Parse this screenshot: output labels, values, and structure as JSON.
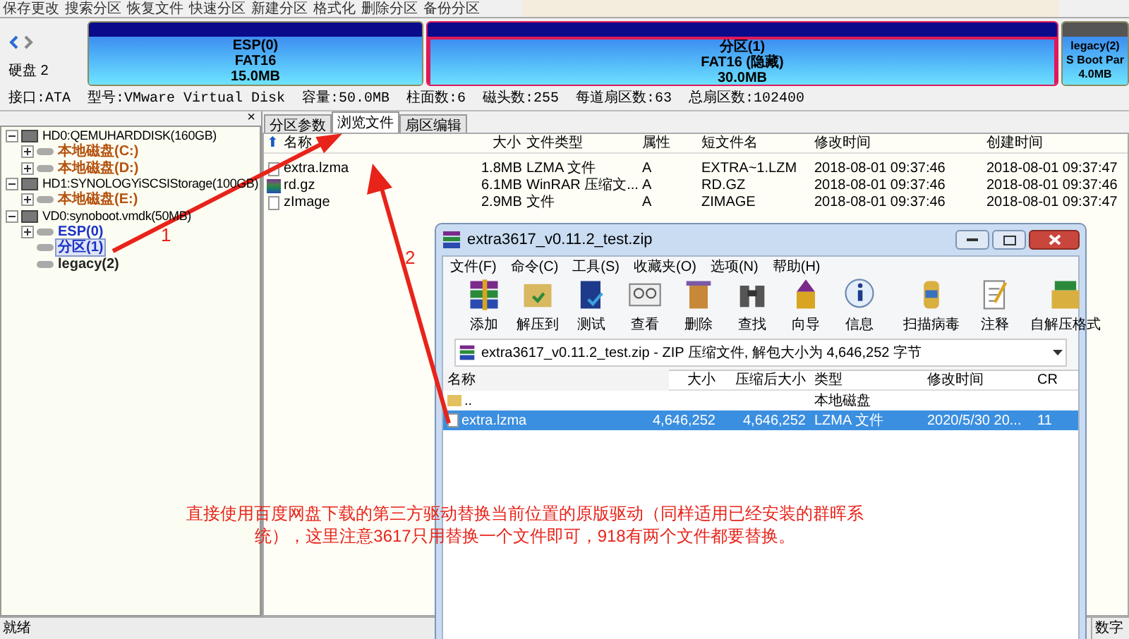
{
  "toolbar": [
    "保存更改",
    "搜索分区",
    "恢复文件",
    "快速分区",
    "新建分区",
    "格式化",
    "删除分区",
    "备份分区"
  ],
  "disk_bar": {
    "label": "硬盘 2",
    "partitions": [
      {
        "name": "ESP(0)",
        "fs": "FAT16",
        "size": "15.0MB",
        "selected": false
      },
      {
        "name": "分区(1)",
        "fs": "FAT16 (隐藏)",
        "size": "30.0MB",
        "selected": true
      },
      {
        "name": "legacy(2)",
        "fs": "S Boot Par",
        "size": "4.0MB",
        "selected": false
      }
    ]
  },
  "disk_info": "接口:ATA  型号:VMware Virtual Disk  容量:50.0MB  柱面数:6  磁头数:255  每道扇区数:63  总扇区数:102400",
  "tree_panel": {
    "close": "×"
  },
  "tree": [
    {
      "label": "HD0:QEMUHARDDISK(160GB)",
      "kind": "disk",
      "expanded": true,
      "children": [
        {
          "label": "本地磁盘(C:)",
          "kind": "partition",
          "expander": true,
          "selected": false,
          "color": "#b5530f"
        },
        {
          "label": "本地磁盘(D:)",
          "kind": "partition",
          "expander": true,
          "selected": false,
          "color": "#b5530f"
        }
      ]
    },
    {
      "label": "HD1:SYNOLOGYiSCSIStorage(100GB)",
      "kind": "disk",
      "expanded": true,
      "children": [
        {
          "label": "本地磁盘(E:)",
          "kind": "partition",
          "expander": true,
          "selected": false,
          "color": "#b5530f"
        }
      ]
    },
    {
      "label": "VD0:synoboot.vmdk(50MB)",
      "kind": "disk",
      "expanded": true,
      "children": [
        {
          "label": "ESP(0)",
          "kind": "partition",
          "expander": true,
          "selected": false,
          "color": "#1a33c8"
        },
        {
          "label": "分区(1)",
          "kind": "partition",
          "expander": false,
          "selected": true,
          "color": "#1a33c8"
        },
        {
          "label": "legacy(2)",
          "kind": "partition",
          "expander": false,
          "selected": false,
          "color": "#222222"
        }
      ]
    }
  ],
  "tabs": [
    {
      "label": "分区参数",
      "selected": false
    },
    {
      "label": "浏览文件",
      "selected": true
    },
    {
      "label": "扇区编辑",
      "selected": false
    }
  ],
  "files": {
    "up": "⬆",
    "columns": [
      "名称",
      "大小",
      "文件类型",
      "属性",
      "短文件名",
      "修改时间",
      "创建时间"
    ],
    "rows": [
      {
        "kind": "file",
        "cells": [
          "extra.lzma",
          "1.8MB",
          "LZMA 文件",
          "A",
          "EXTRA~1.LZM",
          "2018-08-01 09:37:46",
          "2018-08-01 09:37:47"
        ]
      },
      {
        "kind": "archive",
        "cells": [
          "rd.gz",
          "6.1MB",
          "WinRAR 压缩文...",
          "A",
          "RD.GZ",
          "2018-08-01 09:37:46",
          "2018-08-01 09:37:46"
        ]
      },
      {
        "kind": "file",
        "cells": [
          "zImage",
          "2.9MB",
          "文件",
          "A",
          "ZIMAGE",
          "2018-08-01 09:37:46",
          "2018-08-01 09:37:47"
        ]
      }
    ]
  },
  "winrar": {
    "title": "extra3617_v0.11.2_test.zip",
    "menu": [
      "文件(F)",
      "命令(C)",
      "工具(S)",
      "收藏夹(O)",
      "选项(N)",
      "帮助(H)"
    ],
    "tools": [
      "添加",
      "解压到",
      "测试",
      "查看",
      "删除",
      "查找",
      "向导",
      "信息",
      "扫描病毒",
      "注释",
      "自解压格式"
    ],
    "path": "extra3617_v0.11.2_test.zip - ZIP 压缩文件, 解包大小为 4,646,252 字节",
    "columns": [
      "名称",
      "大小",
      "压缩后大小",
      "类型",
      "修改时间",
      "CR"
    ],
    "rows": [
      {
        "kind": "parent",
        "selected": false,
        "cells": [
          "..",
          "",
          "",
          "本地磁盘",
          "",
          ""
        ]
      },
      {
        "kind": "file",
        "selected": true,
        "cells": [
          "extra.lzma",
          "4,646,252",
          "4,646,252",
          "LZMA 文件",
          "2020/5/30 20...",
          "11"
        ]
      }
    ]
  },
  "annotations": {
    "labels": [
      "1",
      "2"
    ],
    "note": "直接使用百度网盘下载的第三方驱动替换当前位置的原版驱动（同样适用已经安装的群晖系统），这里注意3617只用替换一个文件即可，918有两个文件都要替换。"
  },
  "status_bar": {
    "left": "就绪",
    "right": "数字"
  }
}
